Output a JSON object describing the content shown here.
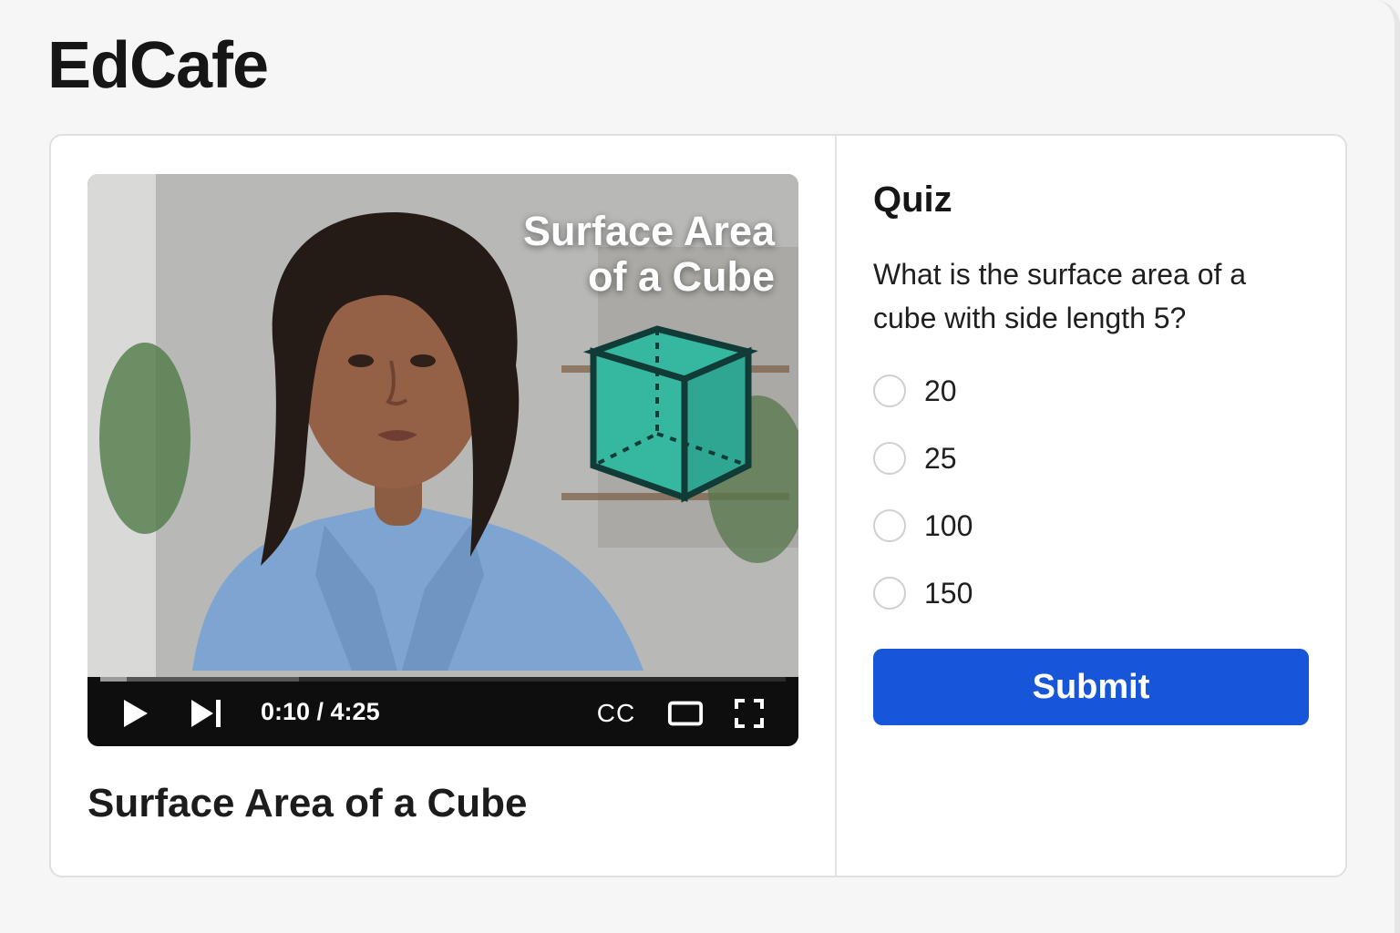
{
  "app": {
    "title": "EdCafe"
  },
  "video": {
    "overlay_title_line1": "Surface Area",
    "overlay_title_line2": "of a Cube",
    "current_time": "0:10",
    "duration": "4:25",
    "time_display": "0:10 / 4:25",
    "progress": 0.038,
    "buffered": 0.29,
    "cc_label": "CC",
    "title": "Surface Area of a Cube",
    "icons": {
      "play": "play-icon",
      "next": "skip-next-icon",
      "captions": "captions-icon",
      "theater": "theater-mode-icon",
      "fullscreen": "fullscreen-icon"
    }
  },
  "quiz": {
    "title": "Quiz",
    "question": "What is the surface area of a cube with side length 5?",
    "options": [
      "20",
      "25",
      "100",
      "150"
    ],
    "submit_label": "Submit"
  },
  "colors": {
    "primary": "#1756d8",
    "cube": "#35b7a0",
    "text": "#161616"
  }
}
